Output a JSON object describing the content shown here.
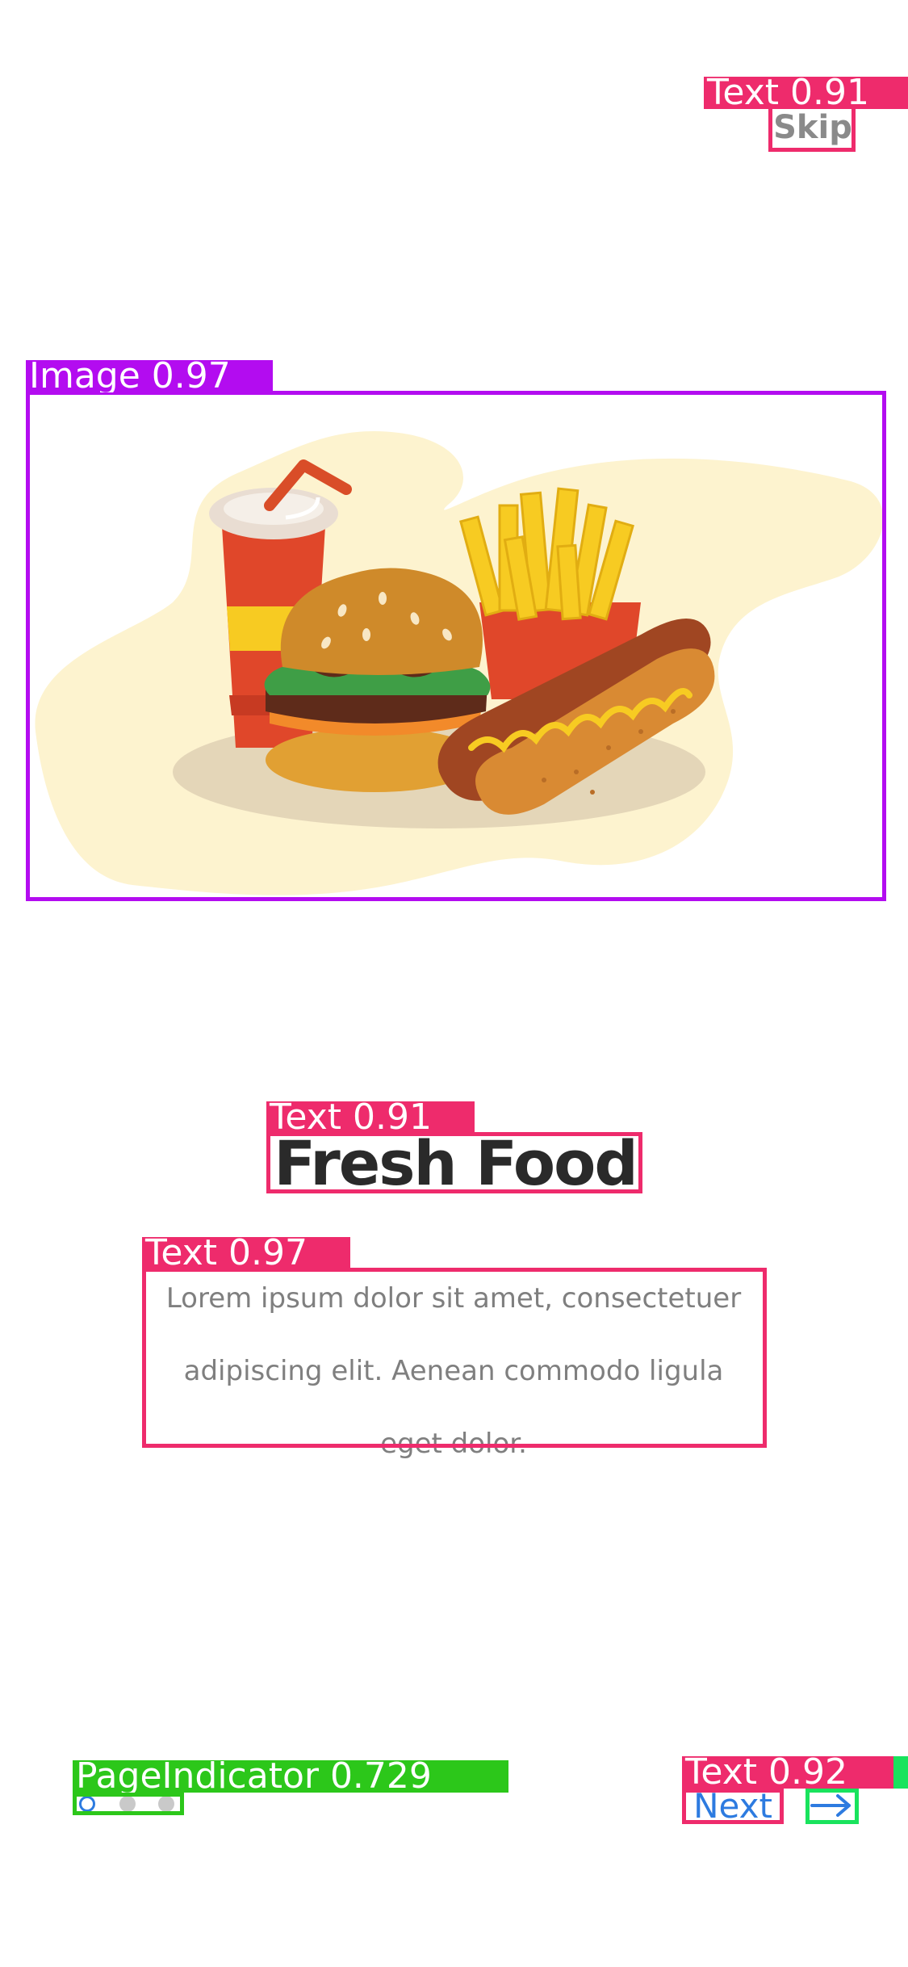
{
  "onboarding": {
    "skip_label": "Skip",
    "title": "Fresh Food",
    "description_lines": [
      "Lorem ipsum dolor sit amet, consectetuer",
      "adipiscing elit. Aenean commodo ligula",
      "eget dolor."
    ],
    "next_label": "Next",
    "hero_image_icon": "fast-food-illustration",
    "page_indicator": {
      "total": 3,
      "current": 1
    }
  },
  "detections": {
    "skip": "Text 0.91",
    "hero": "Image 0.97",
    "title": "Text 0.91",
    "description": "Text 0.97",
    "page_indicator": "PageIndicator 0.729",
    "next": "Text 0.92"
  },
  "colors": {
    "text_box": "#ee2b6c",
    "image_box": "#b30cf0",
    "indicator_box": "#2cc71a",
    "icon_box": "#19e35d",
    "accent": "#2d7be0",
    "title": "#2a2a2a",
    "body_text": "#7f7f7f"
  }
}
